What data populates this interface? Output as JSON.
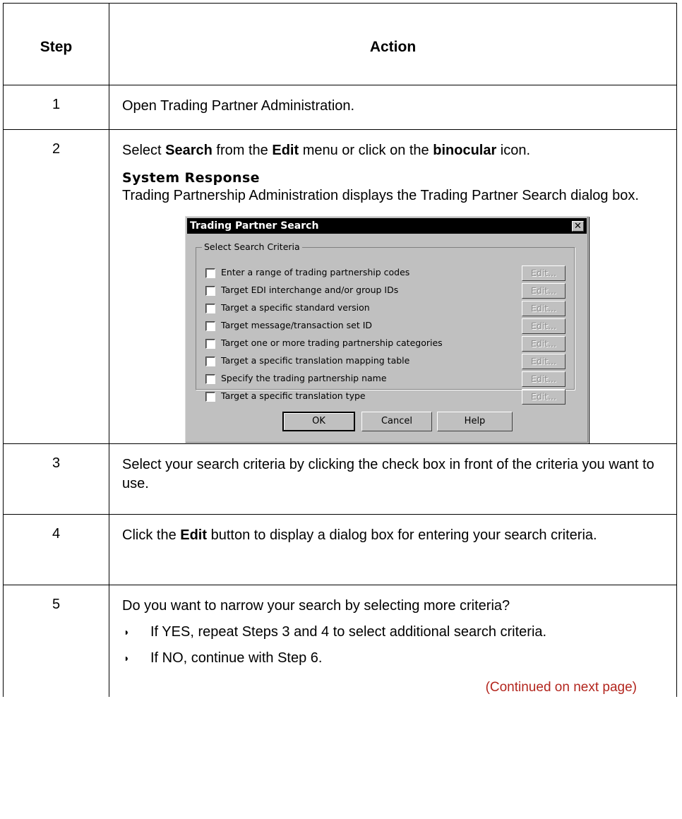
{
  "table": {
    "header": {
      "step": "Step",
      "action": "Action"
    },
    "rows": [
      {
        "step": "1",
        "text": "Open Trading Partner Administration."
      },
      {
        "step": "2",
        "text_before_search": "Select ",
        "bold_search": "Search",
        "text_from_the": " from the ",
        "bold_edit": "Edit",
        "text_menu": " menu or click on the ",
        "bold_binocular": "binocular",
        "text_icon": " icon.",
        "system_response_heading": "System Response",
        "system_response_text": "Trading Partnership Administration displays the Trading Partner Search dialog box."
      },
      {
        "step": "3",
        "text": "Select your search criteria by clicking the check box in front of the criteria you want to use."
      },
      {
        "step": "4",
        "text_click": "Click the ",
        "bold_edit": "Edit",
        "text_rest": " button to display a dialog box for entering your search criteria."
      },
      {
        "step": "5",
        "question": "Do you want to narrow your search by selecting more criteria?",
        "bullets": [
          "If YES, repeat Steps 3 and 4 to select additional search criteria.",
          "If NO, continue with Step 6."
        ],
        "continued": "(Continued on next page)"
      }
    ]
  },
  "dialog": {
    "title": "Trading Partner Search",
    "close_glyph": "✕",
    "group_label": "Select Search Criteria",
    "criteria": [
      {
        "label": "Enter a range of trading partnership codes",
        "checked": false,
        "edit": "Edit..."
      },
      {
        "label": "Target EDI interchange and/or group IDs",
        "checked": false,
        "edit": "Edit..."
      },
      {
        "label": "Target a specific standard version",
        "checked": false,
        "edit": "Edit..."
      },
      {
        "label": "Target message/transaction set ID",
        "checked": false,
        "edit": "Edit..."
      },
      {
        "label": "Target one or more trading partnership categories",
        "checked": false,
        "edit": "Edit..."
      },
      {
        "label": "Target a specific translation mapping table",
        "checked": false,
        "edit": "Edit..."
      },
      {
        "label": "Specify the trading partnership name",
        "checked": false,
        "edit": "Edit..."
      },
      {
        "label": "Target a specific translation type",
        "checked": false,
        "edit": "Edit..."
      }
    ],
    "buttons": {
      "ok": "OK",
      "cancel": "Cancel",
      "help": "Help"
    }
  },
  "colors": {
    "continued": "#b3261e",
    "dialog_face": "#c0c0c0",
    "titlebar": "#000000"
  },
  "icons": {
    "bullet": "◗"
  }
}
